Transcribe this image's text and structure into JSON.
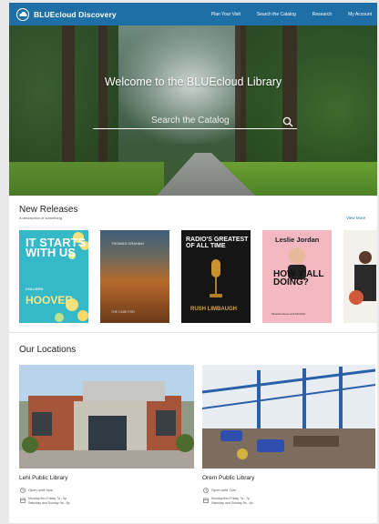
{
  "header": {
    "brand": "BLUEcloud Discovery",
    "nav": [
      "Plan Your Visit",
      "Search the Catalog",
      "Research",
      "My Account"
    ]
  },
  "hero": {
    "title": "Welcome to the BLUEcloud Library",
    "search_placeholder": "Search the Catalog"
  },
  "new_releases": {
    "title": "New Releases",
    "subtitle": "A description of something",
    "view_all": "View More",
    "books": [
      {
        "line1": "IT STARTS WITH US",
        "author": "HOOVER",
        "tag": "COLLEEN"
      },
      {
        "top": "THOMAS GRAHAM",
        "bottom": "THE CASE FOR"
      },
      {
        "line1": "RADIO'S GREATEST OF ALL TIME",
        "author": "RUSH LIMBAUGH"
      },
      {
        "line1": "Leslie Jordan",
        "title": "HOW Y'ALL DOING?",
        "sub": "Misadventures and Mischief"
      }
    ]
  },
  "locations": {
    "title": "Our Locations",
    "items": [
      {
        "name": "Lehi Public Library",
        "status": "Open until 9pm",
        "hours": [
          "Monday thru Friday 7a - 9p",
          "Saturday and Sunday 9a - 6p"
        ]
      },
      {
        "name": "Orem Public Library",
        "status": "Open until 7pm",
        "hours": [
          "Monday thru Friday 7a - 7p",
          "Saturday and Sunday 9a - 6p"
        ]
      }
    ]
  },
  "colors": {
    "primary": "#1d6fa5",
    "header_text": "#ffffff"
  }
}
